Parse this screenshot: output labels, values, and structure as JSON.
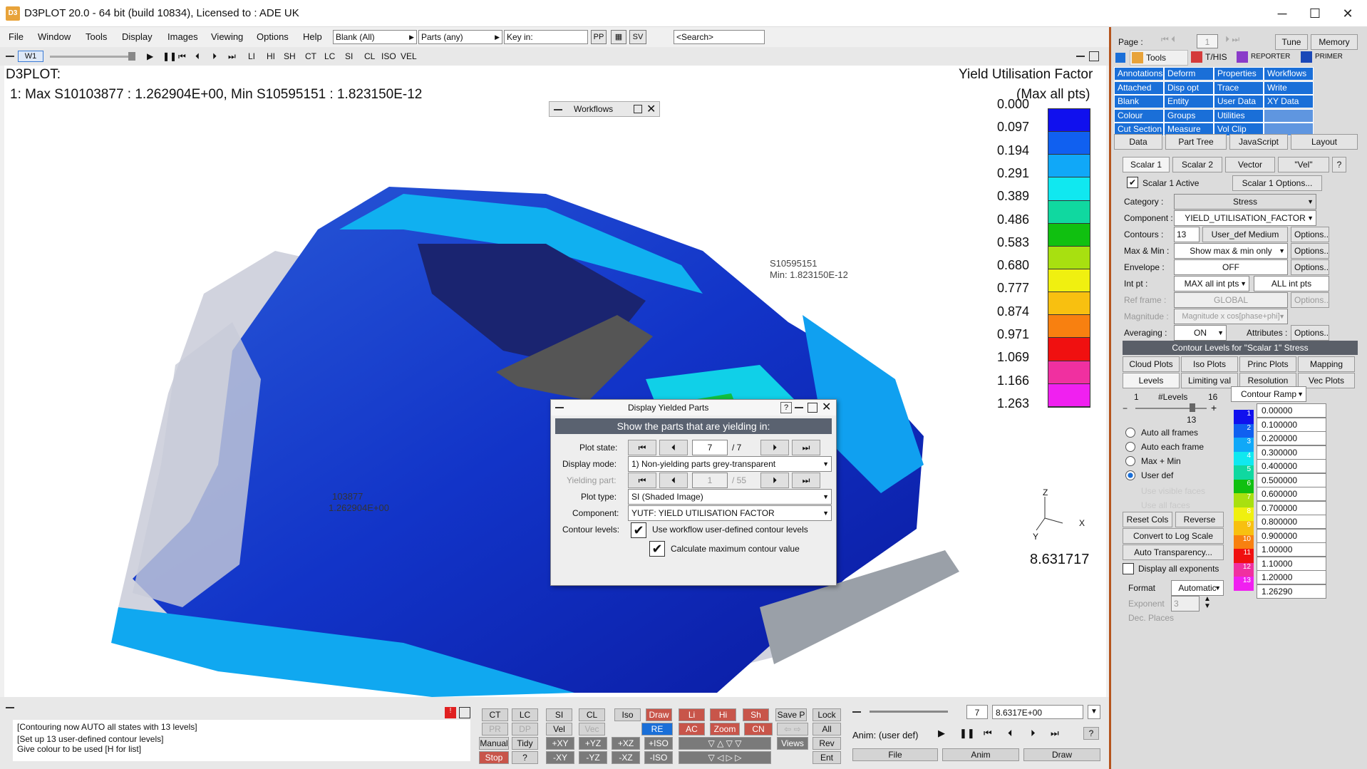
{
  "window": {
    "title": "D3PLOT 20.0 - 64 bit (build 10834), Licensed to : ADE UK",
    "icon": "D3",
    "min": "─",
    "max": "☐",
    "close": "✕"
  },
  "menu": {
    "items": [
      "File",
      "Window",
      "Tools",
      "Display",
      "Images",
      "Viewing",
      "Options",
      "Help"
    ],
    "blank": "Blank (All)",
    "parts": "Parts (any)",
    "key": "Key in:",
    "pp": "PP",
    "sv": "SV",
    "search": "<Search>"
  },
  "anim": {
    "win": "W1",
    "labels": [
      "LI",
      "HI",
      "SH",
      "CT",
      "LC",
      "SI",
      "CL",
      "ISO",
      "VEL"
    ]
  },
  "viewport": {
    "title": "D3PLOT:",
    "info": "1: Max S10103877 : 1.262904E+00, Min S10595151 : 1.823150E-12",
    "legend_title": "Yield Utilisation Factor",
    "legend_sub": "(Max all pts)",
    "legend_values": [
      "0.000",
      "0.097",
      "0.194",
      "0.291",
      "0.389",
      "0.486",
      "0.583",
      "0.680",
      "0.777",
      "0.874",
      "0.971",
      "1.069",
      "1.166",
      "1.263"
    ],
    "legend_colors": [
      "#1010ee",
      "#1060f0",
      "#10a8f8",
      "#10e8f0",
      "#10d8a0",
      "#10c010",
      "#a8e010",
      "#f0f010",
      "#f8c010",
      "#f88010",
      "#f01010",
      "#f030a0",
      "#f020f0"
    ],
    "time": "8.631717",
    "max_label": "103877",
    "max_val": "1.262904E+00",
    "min_label": "S10595151",
    "min_val": "Min: 1.823150E-12",
    "workflows": "Workflows",
    "axes": {
      "z": "Z",
      "x": "X",
      "y": "Y"
    }
  },
  "dialog": {
    "title": "Display Yielded Parts",
    "help": "?",
    "header": "Show the parts that are yielding in:",
    "plot_state_label": "Plot state:",
    "plot_state": "7",
    "plot_state_total": "/ 7",
    "display_mode_label": "Display mode:",
    "display_mode": "1) Non-yielding parts grey-transparent",
    "yield_part_label": "Yielding part:",
    "yield_part": "1",
    "yield_part_total": "/ 55",
    "plot_type_label": "Plot type:",
    "plot_type": "SI (Shaded Image)",
    "component_label": "Component:",
    "component": "YUTF: YIELD UTILISATION FACTOR",
    "contour_label": "Contour levels:",
    "contour_opt": "Use workflow user-defined contour levels",
    "calc_opt": "Calculate maximum contour value"
  },
  "right": {
    "page": "Page :",
    "page_val": "1",
    "tune": "Tune",
    "memory": "Memory",
    "tabs": [
      "Tools",
      "T/HIS",
      "REPORTER",
      "PRIMER"
    ],
    "tools": [
      "Annotations",
      "Deform",
      "Properties",
      "Workflows",
      "Attached",
      "Disp opt",
      "Trace",
      "Write",
      "Blank",
      "Entity",
      "User Data",
      "XY Data",
      "Colour",
      "Groups",
      "Utilities",
      "",
      "Cut Section",
      "Measure",
      "Vol Clip",
      ""
    ],
    "subtabs": [
      "Data",
      "Part Tree",
      "JavaScript",
      "Layout"
    ],
    "scalar_tabs": [
      "Scalar 1",
      "Scalar 2",
      "Vector",
      "\"Vel\""
    ],
    "scalar_active": "Scalar 1 Active",
    "scalar_opts": "Scalar 1 Options...",
    "category_l": "Category :",
    "category": "Stress",
    "component_l": "Component :",
    "component": "YIELD_UTILISATION_FACTOR",
    "contours_l": "Contours :",
    "contours": "13",
    "contours_type": "User_def Medium",
    "options": "Options...",
    "maxmin_l": "Max & Min :",
    "maxmin": "Show max & min only",
    "envelope_l": "Envelope :",
    "envelope": "OFF",
    "intpt_l": "Int pt :",
    "intpt": "MAX all int pts",
    "allint": "ALL int pts",
    "ref_l": "Ref frame :",
    "ref": "GLOBAL",
    "mag_l": "Magnitude :",
    "mag": "Magnitude x cos[phase+phi]",
    "avg_l": "Averaging :",
    "avg": "ON",
    "attrs": "Attributes :",
    "contour_header": "Contour Levels for \"Scalar 1\" Stress",
    "ctabs": [
      "Cloud Plots",
      "Iso Plots",
      "Princ Plots",
      "Mapping",
      "Levels",
      "Limiting val",
      "Resolution",
      "Vec Plots"
    ],
    "levels_min": "1",
    "levels_lbl": "#Levels",
    "levels_max": "16",
    "levels_val": "13",
    "ramp": "Contour Ramp",
    "radios": [
      "Auto all frames",
      "Auto each frame",
      "Max + Min",
      "User def"
    ],
    "radios_dis": [
      "Use visible faces",
      "Use all faces"
    ],
    "reset": "Reset Cols",
    "reverse": "Reverse",
    "log": "Convert to Log Scale",
    "autotrans": "Auto Transparency...",
    "exps": "Display all exponents",
    "format_l": "Format",
    "format": "Automatic",
    "exponent_l": "Exponent",
    "exponent": "3",
    "dec_l": "Dec. Places",
    "levels": [
      "0.00000",
      "0.100000",
      "0.200000",
      "0.300000",
      "0.400000",
      "0.500000",
      "0.600000",
      "0.700000",
      "0.800000",
      "0.900000",
      "1.00000",
      "1.10000",
      "1.20000",
      "1.26290"
    ],
    "level_idx": [
      "1",
      "2",
      "3",
      "4",
      "5",
      "6",
      "7",
      "8",
      "9",
      "10",
      "11",
      "12",
      "13",
      ""
    ]
  },
  "bottom": {
    "messages": [
      "[Contouring now AUTO all states  with 13 levels]",
      "[Set up 13 user-defined contour levels]",
      "Give colour to be used [H for list]"
    ],
    "row1": [
      "CT",
      "LC",
      "SI",
      "CL",
      "Iso",
      "Draw",
      "Li",
      "Hi",
      "Sh",
      "Save P",
      "Lock"
    ],
    "row2": [
      "PR",
      "DP",
      "Vel",
      "Vec",
      "RE",
      "AC",
      "Zoom",
      "CN",
      "",
      "All"
    ],
    "row3": [
      "Manual",
      "Tidy",
      "+XY",
      "+YZ",
      "+XZ",
      "+ISO",
      "Views",
      "Rev"
    ],
    "row4": [
      "Stop",
      "?",
      "-XY",
      "-YZ",
      "-XZ",
      "-ISO",
      "Ent"
    ],
    "state": "7",
    "time": "8.6317E+00",
    "anim": "Anim: (user def)",
    "file": "File",
    "anim_btn": "Anim",
    "draw": "Draw"
  }
}
